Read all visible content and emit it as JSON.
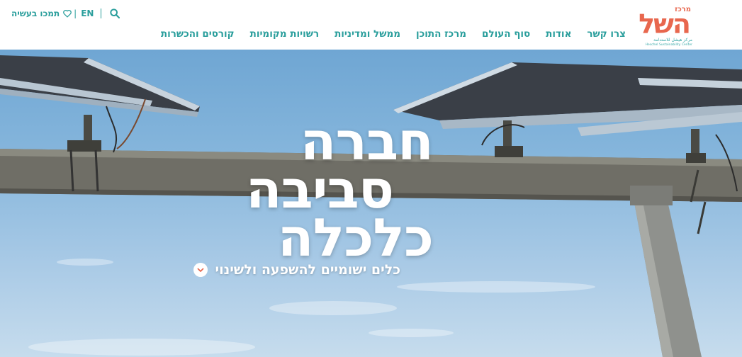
{
  "header": {
    "logo": {
      "small": "מרכז",
      "main": "השל",
      "sub": "مركز هيشل للاستدامة",
      "en": "Heschel Sustainability Center"
    },
    "nav": [
      {
        "label": "קורסים והכשרות"
      },
      {
        "label": "רשויות מקומיות"
      },
      {
        "label": "ממשל ומדיניות"
      },
      {
        "label": "מרכז התוכן"
      },
      {
        "label": "סוף העולם"
      },
      {
        "label": "אודות"
      },
      {
        "label": "צרו קשר"
      }
    ],
    "utility": {
      "donate_label": "תמכו בעשיה",
      "lang_label": "EN",
      "pipe": "|",
      "heart_icon": "heart-icon",
      "search_icon": "search-icon"
    }
  },
  "hero": {
    "headline": [
      "חברה",
      "סביבה",
      "כלכלה"
    ],
    "tagline": "כלים ישומיים להשפעה ולשינוי",
    "scroll_icon": "chevron-down-icon"
  },
  "colors": {
    "accent": "#2a9e9c",
    "logo": "#e8674e",
    "text_on_hero": "#ffffff"
  }
}
